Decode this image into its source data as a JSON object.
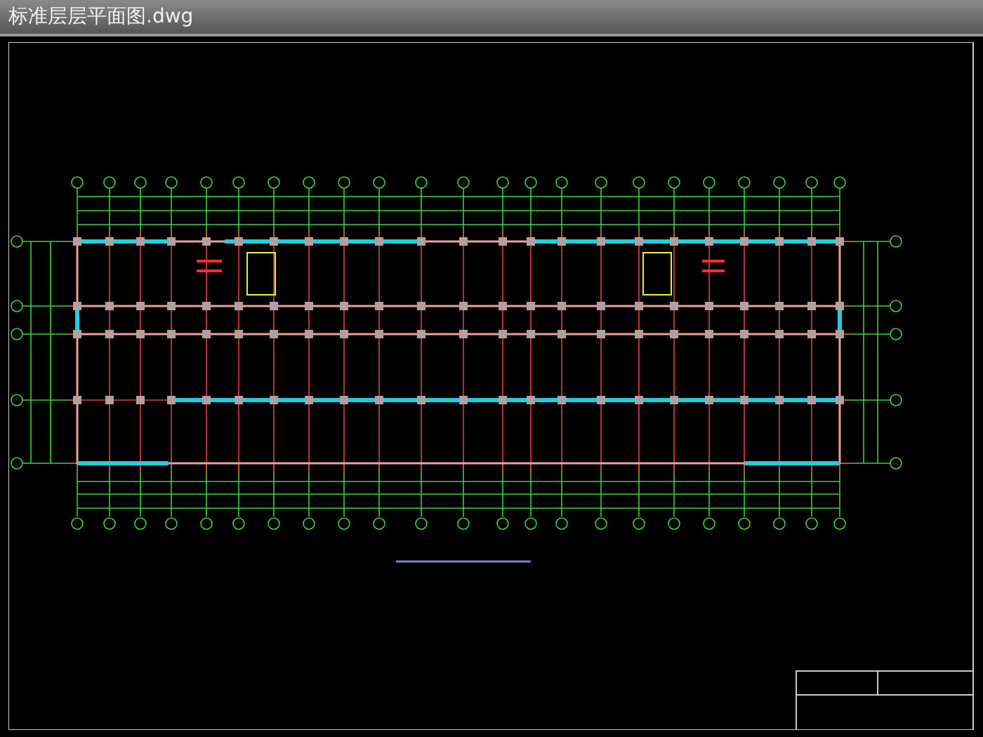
{
  "window": {
    "title": "标准层层平面图.dwg"
  }
}
